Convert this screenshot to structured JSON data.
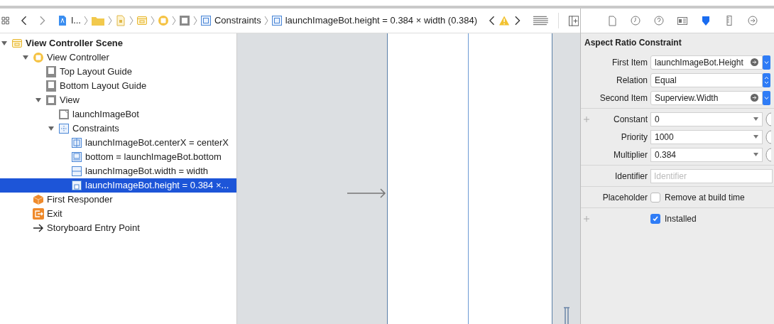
{
  "breadcrumb": [
    {
      "kind": "app",
      "label": "l..."
    },
    {
      "kind": "folder"
    },
    {
      "kind": "storyboard"
    },
    {
      "kind": "scene"
    },
    {
      "kind": "controller"
    },
    {
      "kind": "view"
    },
    {
      "kind": "constraints",
      "label": "Constraints"
    },
    {
      "kind": "constraint",
      "label": "launchImageBot.height = 0.384 × width (0.384)"
    }
  ],
  "outline": [
    {
      "kind": "scene",
      "label": "View Controller Scene",
      "expanded": true,
      "selected": false,
      "children": [
        {
          "kind": "controller",
          "label": "View Controller",
          "expanded": true,
          "selected": false,
          "children": [
            {
              "kind": "guide",
              "label": "Top Layout Guide",
              "selected": false
            },
            {
              "kind": "guide",
              "label": "Bottom Layout Guide",
              "selected": false
            },
            {
              "kind": "view",
              "label": "View",
              "expanded": true,
              "selected": false,
              "children": [
                {
                  "kind": "image",
                  "label": "launchImageBot",
                  "selected": false
                },
                {
                  "kind": "constraints",
                  "label": "Constraints",
                  "expanded": true,
                  "selected": false,
                  "children": [
                    {
                      "kind": "centerx",
                      "label": "launchImageBot.centerX = centerX",
                      "selected": false
                    },
                    {
                      "kind": "bottom",
                      "label": "bottom = launchImageBot.bottom",
                      "selected": false
                    },
                    {
                      "kind": "width",
                      "label": "launchImageBot.width = width",
                      "selected": false
                    },
                    {
                      "kind": "aspect",
                      "label": "launchImageBot.height = 0.384 ×...",
                      "selected": true
                    }
                  ]
                }
              ]
            }
          ]
        },
        {
          "kind": "responder",
          "label": "First Responder",
          "selected": false
        },
        {
          "kind": "exit",
          "label": "Exit",
          "selected": false
        },
        {
          "kind": "entry",
          "label": "Storyboard Entry Point",
          "selected": false
        }
      ]
    }
  ],
  "inspector": {
    "tabs": [
      {
        "kind": "file",
        "selected": false
      },
      {
        "kind": "history",
        "selected": false
      },
      {
        "kind": "help",
        "selected": false
      },
      {
        "kind": "identity",
        "selected": false
      },
      {
        "kind": "attributes",
        "selected": true
      },
      {
        "kind": "size",
        "selected": false
      },
      {
        "kind": "connections",
        "selected": false
      }
    ],
    "title": "Aspect Ratio Constraint",
    "fields": [
      {
        "kind": "popup",
        "label": "First Item",
        "value": "launchImageBot.Height",
        "arrow": true
      },
      {
        "kind": "select",
        "label": "Relation",
        "value": "Equal"
      },
      {
        "kind": "popup",
        "label": "Second Item",
        "value": "Superview.Width",
        "arrow": true
      },
      {
        "kind": "combo",
        "label": "Constant",
        "value": "0",
        "plus": true
      },
      {
        "kind": "combo",
        "label": "Priority",
        "value": "1000"
      },
      {
        "kind": "combo",
        "label": "Multiplier",
        "value": "0.384"
      },
      {
        "kind": "text",
        "label": "Identifier",
        "placeholder": "Identifier"
      },
      {
        "kind": "checkbox",
        "label": "Placeholder",
        "text": "Remove at build time",
        "checked": false
      },
      {
        "kind": "checkbox",
        "text": "Installed",
        "checked": true,
        "plus": true
      }
    ]
  }
}
